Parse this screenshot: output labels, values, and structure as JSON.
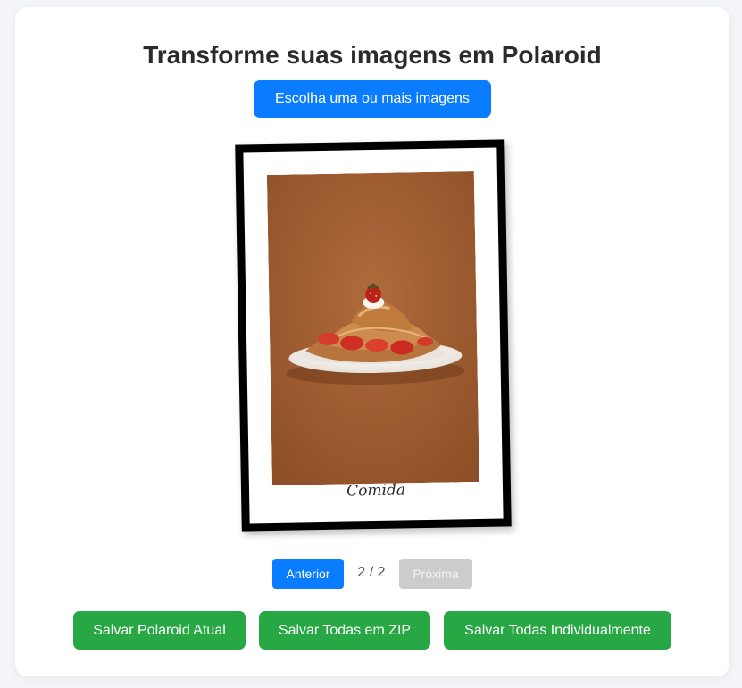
{
  "page": {
    "title": "Transforme suas imagens em Polaroid",
    "choose_button": "Escolha uma ou mais imagens"
  },
  "polaroid": {
    "caption": "Comida",
    "photo_description_icon": "photo-croissant-strawberries"
  },
  "pagination": {
    "prev_label": "Anterior",
    "indicator": "2 / 2",
    "next_label": "Próxima"
  },
  "actions": {
    "save_current": "Salvar Polaroid Atual",
    "save_zip": "Salvar Todas em ZIP",
    "save_individual": "Salvar Todas Individualmente"
  },
  "colors": {
    "primary": "#0a7cff",
    "success": "#28a745",
    "disabled": "#cccccc"
  }
}
